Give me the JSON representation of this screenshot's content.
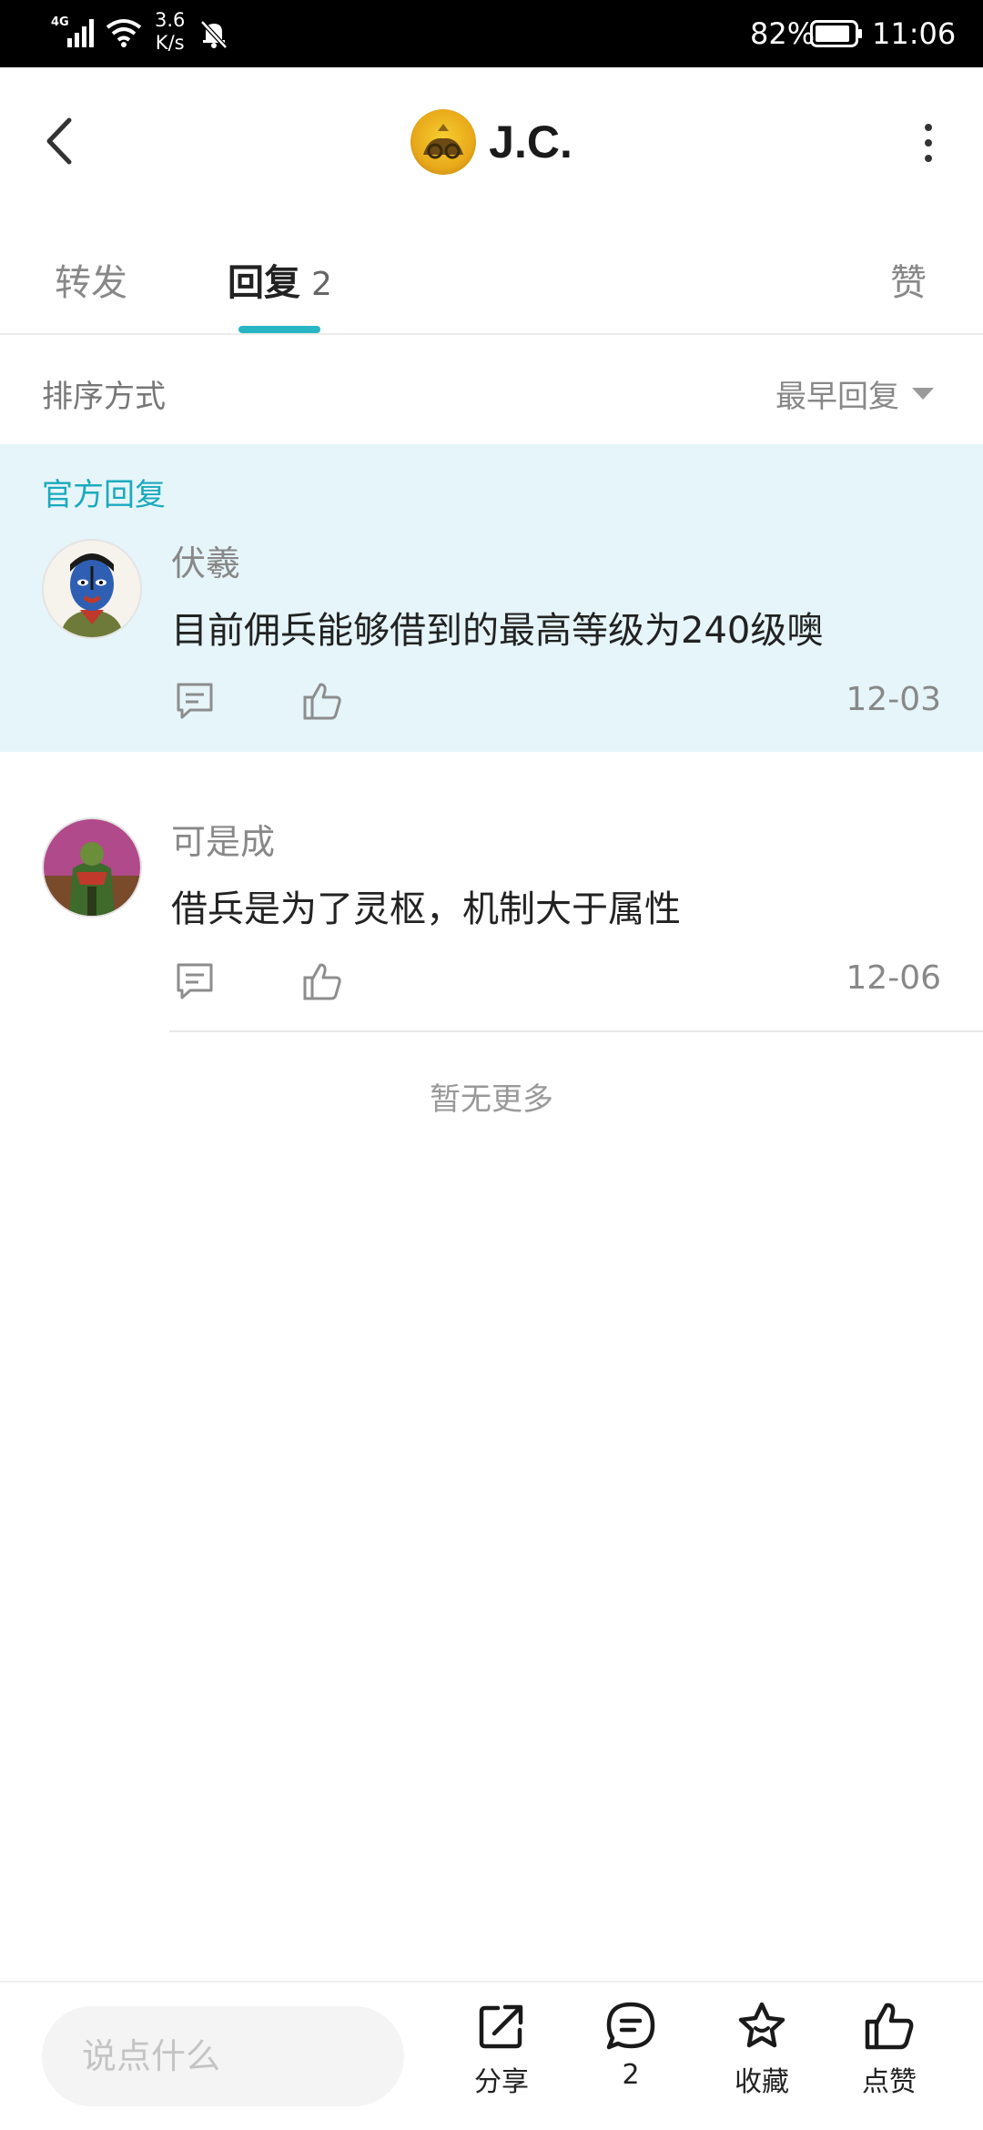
{
  "status_bar": {
    "network": "4G",
    "speed_value": "3.6",
    "speed_unit": "K/s",
    "battery": "82%",
    "time": "11:06"
  },
  "header": {
    "title": "J.C.",
    "back_icon": "chevron-left-icon",
    "more_icon": "more-vertical-icon"
  },
  "tabs": [
    {
      "label": "转发"
    },
    {
      "label": "回复",
      "count": "2"
    },
    {
      "label": "赞"
    }
  ],
  "sort": {
    "label": "排序方式",
    "value": "最早回复"
  },
  "official_label": "官方回复",
  "replies": [
    {
      "name": "伏羲",
      "content": "目前佣兵能够借到的最高等级为240级噢",
      "date": "12-03"
    },
    {
      "name": "可是成",
      "content": "借兵是为了灵枢，机制大于属性",
      "date": "12-06"
    }
  ],
  "no_more": "暂无更多",
  "bottom_bar": {
    "input_placeholder": "说点什么",
    "share_label": "分享",
    "comment_count": "2",
    "favorite_label": "收藏",
    "like_label": "点赞"
  },
  "colors": {
    "accent": "#27b5c4",
    "official_bg": "#e6f5f9",
    "official_label": "#1aaabf"
  }
}
